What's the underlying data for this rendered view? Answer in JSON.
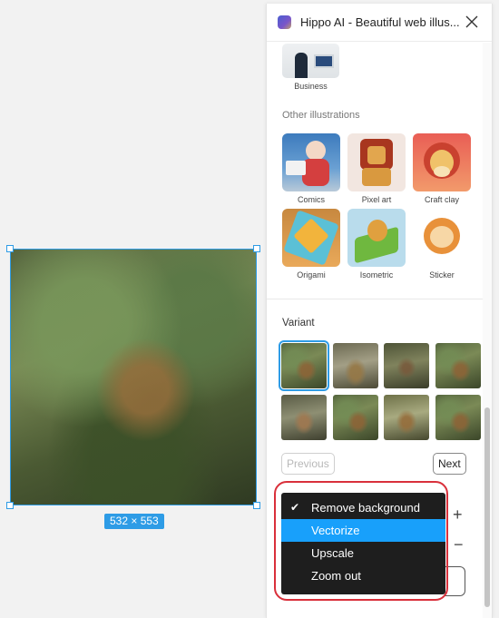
{
  "canvas": {
    "size_label": "532 × 553"
  },
  "panel": {
    "title": "Hippo AI - Beautiful web illus...",
    "business_label": "Business",
    "other_title": "Other illustrations",
    "illustrations": [
      {
        "label": "Comics"
      },
      {
        "label": "Pixel art"
      },
      {
        "label": "Craft clay"
      },
      {
        "label": "Origami"
      },
      {
        "label": "Isometric"
      },
      {
        "label": "Sticker"
      }
    ],
    "variant_title": "Variant",
    "previous_label": "Previous",
    "next_label": "Next",
    "plus": "+",
    "minus": "−"
  },
  "menu": {
    "items": [
      {
        "label": "Remove background",
        "checked": true
      },
      {
        "label": "Vectorize",
        "active": true
      },
      {
        "label": "Upscale"
      },
      {
        "label": "Zoom out"
      }
    ],
    "check": "✔"
  },
  "colors": {
    "accent": "#18a0fb",
    "selection": "#2e9ce6",
    "highlight": "#d9303b"
  }
}
